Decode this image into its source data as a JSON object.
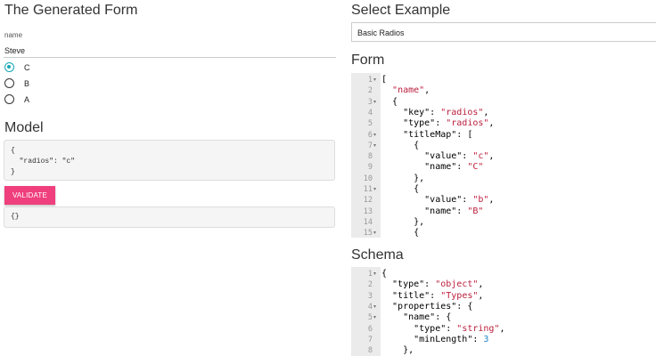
{
  "left": {
    "title": "The Generated Form",
    "name_field": {
      "label": "name",
      "value": "Steve"
    },
    "radios": [
      {
        "label": "C",
        "checked": true
      },
      {
        "label": "B",
        "checked": false
      },
      {
        "label": "A",
        "checked": false
      }
    ],
    "model_title": "Model",
    "model_lines": [
      "{",
      "  \"radios\": \"c\"",
      "}"
    ],
    "validate_label": "VALIDATE",
    "validate_output": "{}"
  },
  "right": {
    "select_title": "Select Example",
    "select_value": "Basic Radios",
    "form_title": "Form",
    "schema_title": "Schema"
  },
  "form_editor": [
    {
      "n": "1",
      "fold": true,
      "tokens": [
        [
          "p",
          "["
        ]
      ]
    },
    {
      "n": "2",
      "fold": false,
      "tokens": [
        [
          "p",
          "  "
        ],
        [
          "s",
          "\"name\""
        ],
        [
          "p",
          ","
        ]
      ]
    },
    {
      "n": "3",
      "fold": true,
      "tokens": [
        [
          "p",
          "  {"
        ]
      ]
    },
    {
      "n": "4",
      "fold": false,
      "tokens": [
        [
          "p",
          "    \"key\": "
        ],
        [
          "s",
          "\"radios\""
        ],
        [
          "p",
          ","
        ]
      ]
    },
    {
      "n": "5",
      "fold": false,
      "tokens": [
        [
          "p",
          "    \"type\": "
        ],
        [
          "s",
          "\"radios\""
        ],
        [
          "p",
          ","
        ]
      ]
    },
    {
      "n": "6",
      "fold": true,
      "tokens": [
        [
          "p",
          "    \"titleMap\": ["
        ]
      ]
    },
    {
      "n": "7",
      "fold": true,
      "tokens": [
        [
          "p",
          "      {"
        ]
      ]
    },
    {
      "n": "8",
      "fold": false,
      "tokens": [
        [
          "p",
          "        \"value\": "
        ],
        [
          "s",
          "\"c\""
        ],
        [
          "p",
          ","
        ]
      ]
    },
    {
      "n": "9",
      "fold": false,
      "tokens": [
        [
          "p",
          "        \"name\": "
        ],
        [
          "s",
          "\"C\""
        ]
      ]
    },
    {
      "n": "10",
      "fold": false,
      "tokens": [
        [
          "p",
          "      },"
        ]
      ]
    },
    {
      "n": "11",
      "fold": true,
      "tokens": [
        [
          "p",
          "      {"
        ]
      ]
    },
    {
      "n": "12",
      "fold": false,
      "tokens": [
        [
          "p",
          "        \"value\": "
        ],
        [
          "s",
          "\"b\""
        ],
        [
          "p",
          ","
        ]
      ]
    },
    {
      "n": "13",
      "fold": false,
      "tokens": [
        [
          "p",
          "        \"name\": "
        ],
        [
          "s",
          "\"B\""
        ]
      ]
    },
    {
      "n": "14",
      "fold": false,
      "tokens": [
        [
          "p",
          "      },"
        ]
      ]
    },
    {
      "n": "15",
      "fold": true,
      "tokens": [
        [
          "p",
          "      {"
        ]
      ]
    }
  ],
  "schema_editor": [
    {
      "n": "1",
      "fold": true,
      "tokens": [
        [
          "p",
          "{"
        ]
      ]
    },
    {
      "n": "2",
      "fold": false,
      "tokens": [
        [
          "p",
          "  \"type\": "
        ],
        [
          "s",
          "\"object\""
        ],
        [
          "p",
          ","
        ]
      ]
    },
    {
      "n": "3",
      "fold": false,
      "tokens": [
        [
          "p",
          "  \"title\": "
        ],
        [
          "s",
          "\"Types\""
        ],
        [
          "p",
          ","
        ]
      ]
    },
    {
      "n": "4",
      "fold": true,
      "tokens": [
        [
          "p",
          "  \"properties\": {"
        ]
      ]
    },
    {
      "n": "5",
      "fold": true,
      "tokens": [
        [
          "p",
          "    \"name\": {"
        ]
      ]
    },
    {
      "n": "6",
      "fold": false,
      "tokens": [
        [
          "p",
          "      \"type\": "
        ],
        [
          "s",
          "\"string\""
        ],
        [
          "p",
          ","
        ]
      ]
    },
    {
      "n": "7",
      "fold": false,
      "tokens": [
        [
          "p",
          "      \"minLength\": "
        ],
        [
          "n",
          "3"
        ]
      ]
    },
    {
      "n": "8",
      "fold": false,
      "tokens": [
        [
          "p",
          "    },"
        ]
      ]
    }
  ],
  "colors": {
    "accent": "#ef3f7c",
    "radio": "#16a6b6",
    "string": "#bb1e3c",
    "number": "#1e86c8"
  }
}
